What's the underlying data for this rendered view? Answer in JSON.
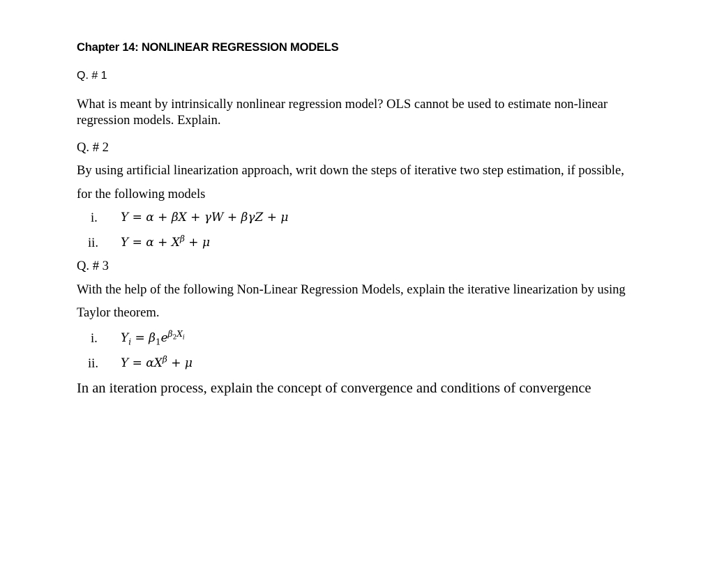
{
  "chapter_title": "Chapter 14: NONLINEAR REGRESSION MODELS",
  "questions": [
    {
      "label": "Q. # 1",
      "lines": [
        "What is meant by intrinsically nonlinear regression model? OLS cannot be used to estimate non-linear",
        "regression models. Explain."
      ]
    },
    {
      "label": "Q. # 2",
      "lines": [
        "By using artificial linearization approach, writ down the steps of iterative two step estimation, if possible,",
        "for the following models"
      ],
      "models": [
        {
          "numeral": "i.",
          "lhs": "Y",
          "equals": "=",
          "terms": [
            "α +",
            "βX + γW +",
            "βγZ + μ"
          ]
        },
        {
          "numeral": "ii.",
          "lhs": "Y",
          "equals": "=",
          "pre": "α +",
          "base": "X",
          "exp": "β",
          "post": "+ μ"
        }
      ]
    },
    {
      "label": "Q. # 3",
      "lines": [
        "With the help of the following Non-Linear Regression Models, explain the iterative linearization by using",
        "Taylor theorem."
      ],
      "models": [
        {
          "numeral": "i.",
          "lhs": "Y",
          "lhs_sub": "i",
          "equals": "=",
          "coef": "β",
          "coef_sub": "1",
          "base": "e",
          "exp": "β",
          "exp_sub": "2",
          "exp_var": "X",
          "exp_var_sub": "i"
        },
        {
          "numeral": "ii.",
          "lhs": "Y",
          "equals": "=",
          "pre": "αX",
          "exp": "β",
          "post": "+ μ"
        }
      ]
    }
  ],
  "closing_statement": "In an iteration process, explain the concept of convergence and conditions of convergence"
}
